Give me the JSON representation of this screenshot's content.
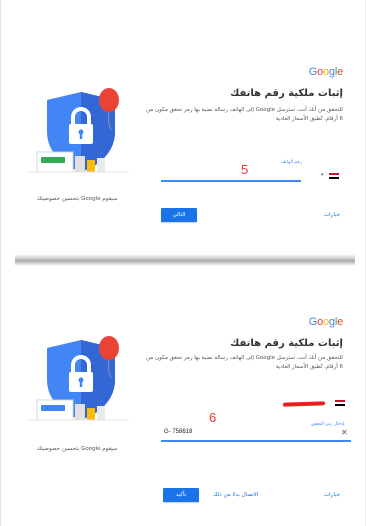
{
  "colors": {
    "google_blue": "#1a73e8",
    "annotation_red": "#e53935",
    "shield_blue": "#4285f4",
    "balloon_red": "#ea4335"
  },
  "top": {
    "logo": [
      "G",
      "o",
      "o",
      "g",
      "l",
      "e"
    ],
    "title": "إثبات ملكية رقم هاتفك",
    "description": "للتحقق من أنك أنت، سترسل Google إلى الهاتف رسالة نصية بها رمز تحقق مكون من 6 أرقام. تُطبق الأسعار العادية",
    "caption": "سيقوم Google بتحسين خصوصيتك",
    "field_label": "رقم الهاتف",
    "annotation": "5",
    "next_button": "التالي",
    "more_link": "خيارات"
  },
  "bottom": {
    "logo": [
      "G",
      "o",
      "o",
      "g",
      "l",
      "e"
    ],
    "title": "إثبات ملكية رقم هاتفك",
    "description": "للتحقق من أنك أنت، سترسل Google إلى الهاتف رسالة نصية بها رمز تحقق مكون من 6 أرقام. تُطبق الأسعار العادية",
    "caption": "سيقوم Google بتحسين خصوصيتك",
    "field_label": "إدخال رمز التحقق",
    "code_value": "G- 758618",
    "annotation": "6",
    "confirm_button": "تأكيد",
    "resend_link": "الاتصال بدلا من ذلك",
    "more_link": "خيارات"
  }
}
